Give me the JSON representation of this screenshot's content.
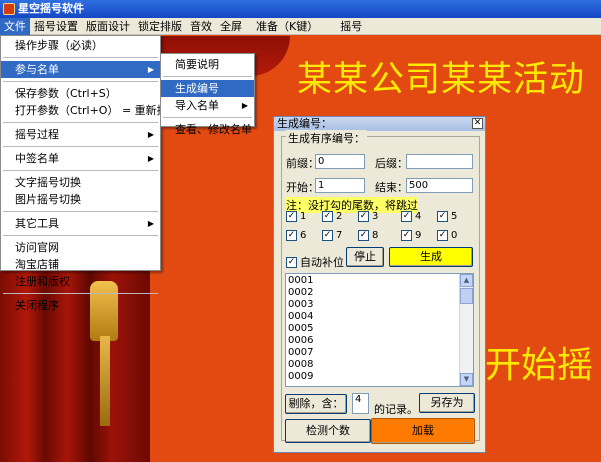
{
  "app": {
    "title": "星空摇号软件"
  },
  "menubar": [
    "文件",
    "摇号设置",
    "版面设计",
    "锁定排版",
    "音效",
    "全屏",
    "准备（K键）",
    "摇号"
  ],
  "stage": {
    "big_title": "某某公司某某活动",
    "start_text": "开始摇"
  },
  "file_menu": {
    "items": [
      "操作步骤（必读）",
      "参与名单",
      "保存参数（Ctrl+S）",
      "打开参数（Ctrl+O） = 重新抽",
      "摇号过程",
      "中签名单",
      "文字摇号切换",
      "图片摇号切换",
      "其它工具",
      "访问官网",
      "淘宝店铺",
      "注册和版权",
      "关闭程序"
    ]
  },
  "sub_menu": {
    "items": [
      "简要说明",
      "生成编号",
      "导入名单",
      "查看、修改名单"
    ]
  },
  "dialog": {
    "title": "生成编号：",
    "group_caption": "生成有序编号：",
    "prefix_label": "前缀：",
    "prefix_value": "0",
    "suffix_label": "后缀：",
    "suffix_value": "",
    "start_label": "开始：",
    "start_value": "1",
    "end_label": "结束：",
    "end_value": "500",
    "note": "注：没打勾的尾数，将跳过",
    "digits": [
      "1",
      "2",
      "3",
      "4",
      "5",
      "6",
      "7",
      "8",
      "9",
      "0"
    ],
    "auto_pad_label": "自动补位",
    "stop_label": "停止",
    "generate_label": "生成",
    "list_items": [
      "0001",
      "0002",
      "0003",
      "0004",
      "0005",
      "0006",
      "0007",
      "0008",
      "0009"
    ],
    "remove_label": "剔除，含：",
    "remove_value": "4",
    "records_label": "的记录。",
    "save_as_label": "另存为",
    "check_count_label": "检测个数",
    "load_label": "加载"
  },
  "colors": {
    "background": "#e24a12",
    "big_text": "#ffea00",
    "generate_btn": "#ffff00",
    "load_btn": "#ff7a00"
  }
}
